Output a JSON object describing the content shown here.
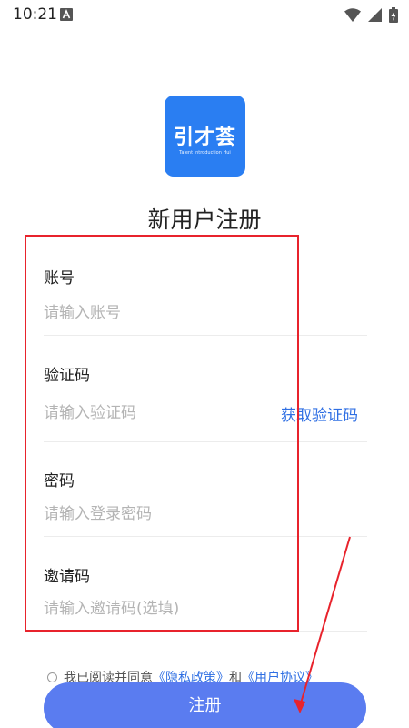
{
  "status_bar": {
    "time": "10:21",
    "left_icon": "a-notification-icon",
    "right_icons": [
      "wifi-icon",
      "signal-icon",
      "battery-charging-icon"
    ]
  },
  "logo": {
    "main_text": "引才荟",
    "sub_text": "Talent Introduction Hui"
  },
  "page_title": "新用户注册",
  "form": {
    "account": {
      "label": "账号",
      "placeholder": "请输入账号"
    },
    "code": {
      "label": "验证码",
      "placeholder": "请输入验证码",
      "action": "获取验证码"
    },
    "password": {
      "label": "密码",
      "placeholder": "请输入登录密码"
    },
    "invite": {
      "label": "邀请码",
      "placeholder": "请输入邀请码(选填)"
    }
  },
  "agreement": {
    "prefix": "我已阅读并同意",
    "privacy": "《隐私政策》",
    "joiner": "和",
    "terms": "《用户协议》"
  },
  "register_label": "注册",
  "colors": {
    "brand_blue": "#2a7ef2",
    "link_blue": "#2f6fe3",
    "button_blue": "#5a7cf0",
    "annotation_red": "#e8232c"
  }
}
